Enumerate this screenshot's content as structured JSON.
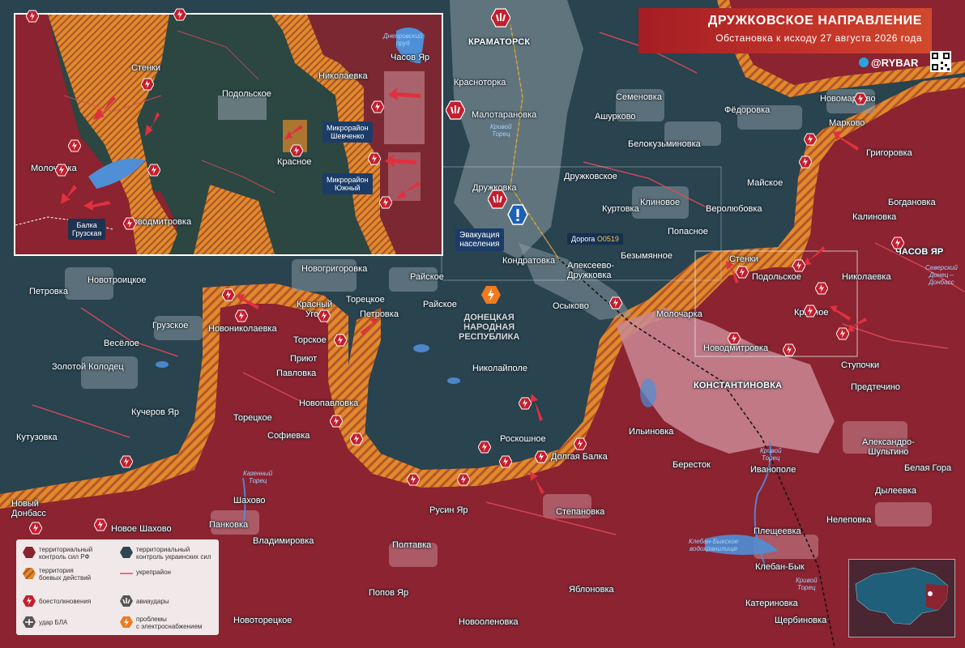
{
  "header": {
    "title": "ДРУЖКОВСКОЕ НАПРАВЛЕНИЕ",
    "subtitle": "Обстановка к исходу 27 августа 2026 года",
    "brand": "@RYBAR"
  },
  "colors": {
    "ru": "#8b2330",
    "ua": "#2d4753",
    "combat": "#e08a2c",
    "accent": "#c7382a",
    "line": "#e24a5a"
  },
  "towns": {
    "kramatorsk": "КРАМАТОРСК",
    "krasnotorka": "Красноторка",
    "malotaranovka": "Малотарановка",
    "semenovka": "Семеновка",
    "fedorovka": "Фёдоровка",
    "novomarkovo": "Новомарково",
    "ashurkovo": "Ашурково",
    "markovo": "Марково",
    "belokuzminovka": "Белокузьминовка",
    "grigorovka": "Григоровка",
    "druzhkovskoe": "Дружковское",
    "druzhkovka": "Дружковка",
    "mayskoe": "Майское",
    "bogdanovka": "Богдановка",
    "klinovoe": "Клиновое",
    "kurtovka": "Куртовка",
    "verolyubovka": "Веролюбовка",
    "kalinovka": "Калиновка",
    "popasnoe": "Попасное",
    "chasov_yar": "ЧАСОВ ЯР",
    "bezymyannoe": "Безымянное",
    "kondratovka": "Кондратовка",
    "alekseevo": "Алексеево-\nДружковка",
    "stenki": "Стенки",
    "podolskoe": "Подольское",
    "nikolaevka": "Николаевка",
    "novogrigorovka": "Новогригоровка",
    "novotroitskoe": "Новотроицкое",
    "petrovka_w": "Петровка",
    "raiskoe_n": "Райское",
    "toretskoe_n": "Торецкое",
    "krasny_ugol": "Красный\nУгол",
    "petrovka": "Петровка",
    "raiskoe": "Райское",
    "osykovo": "Осыково",
    "molocharka": "Молочарка",
    "krasnoe": "Красное",
    "novodmitrovka": "Новодмитровка",
    "novonikolaevka": "Новониколаевка",
    "gruzskoe": "Грузское",
    "torskoe": "Торское",
    "veseloe": "Весёлое",
    "priyut": "Приют",
    "pavlovka": "Павловка",
    "zolotoy_kolodets": "Золотой Колодец",
    "novopavlovka": "Новопавловка",
    "nikolaypole": "Николайполе",
    "konstantinovka": "КОНСТАНТИНОВКА",
    "stupochki": "Ступочки",
    "predtechino": "Предтечино",
    "kucherov_yar": "Кучеров Яр",
    "toretskoe_s": "Торецкое",
    "ilinovka": "Ильиновка",
    "kutuzovka": "Кутузовка",
    "sofievka": "Софиевка",
    "roskoshnoe": "Роскошное",
    "dolgaya_balka": "Долгая Балка",
    "aleksandro": "Александро-\nШультино",
    "berestok": "Бересток",
    "belaya_gora": "Белая Гора",
    "ivanopole": "Иванополе",
    "dyleevka": "Дылеевка",
    "shakhovo": "Шахово",
    "rusin_yar": "Русин Яр",
    "stepanovka": "Степановка",
    "neleпovka": "Нелеповка",
    "novy_donbass": "Новый\nДонбасс",
    "novoe_shakhovo": "Новое Шахово",
    "pankovka": "Панковка",
    "pleshcheevka": "Плещеевка",
    "vladimirovka": "Владимировка",
    "poltavka": "Полтавка",
    "kleban_byk": "Клебан-Бык",
    "popov_yar": "Попов Яр",
    "yablonovka": "Яблоновка",
    "katerinovka": "Катериновка",
    "novotoretskoe": "Новоторецкое",
    "novoolenovka": "Новооленовка",
    "shcherbinovka": "Щербиновка"
  },
  "water": {
    "krivoy_torets_n": "Кривой\nТорец",
    "severskiy_donets": "Северский\nДонец –\nДонбасс",
    "kazenny_torets": "Казенный\nТорец",
    "krivoy_torets_s": "Кривой\nТорец",
    "kleban_res": "Клебан-Быкское\nводохранилище",
    "krivoy_torets_e": "Кривой\nТорец"
  },
  "region": "ДОНЕЦКАЯ\nНАРОДНАЯ\nРЕСПУБЛИКА",
  "callouts": {
    "evacuation": "Эвакуация\nнаселения",
    "road_prefix": "Дорога ",
    "road_code": "O0519"
  },
  "inset": {
    "stenki": "Стенки",
    "podolskoe": "Подольское",
    "nikolaevka": "Николаевка",
    "chasov_yar": "Часов Яр",
    "dneprovsky": "Днепровский\nпруд",
    "mkr_shevchenko": "Микрорайон\nШевченко",
    "molocharka": "Молочарка",
    "krasnoe": "Красное",
    "mkr_yuzhny": "Микрорайон\nЮжный",
    "novodmitrovka": "Новодмитровка",
    "balka": "Балка\nГрузская"
  },
  "legend": {
    "ru": "территориальный\nконтроль сил РФ",
    "ua": "территориальный\nконтроль украинских сил",
    "combat": "территория\nбоевых действий",
    "fort": "укрепрайон",
    "clash": "боестолкновения",
    "air": "авиаудары",
    "uav": "удар БЛА",
    "power": "проблемы\nс электроснабжением"
  },
  "icons": {
    "clash": "clash-icon",
    "air": "airstrike-icon",
    "uav": "uav-strike-icon",
    "power": "power-icon",
    "alert": "alert-icon",
    "telegram": "telegram-icon",
    "qr": "qr-code-icon"
  }
}
